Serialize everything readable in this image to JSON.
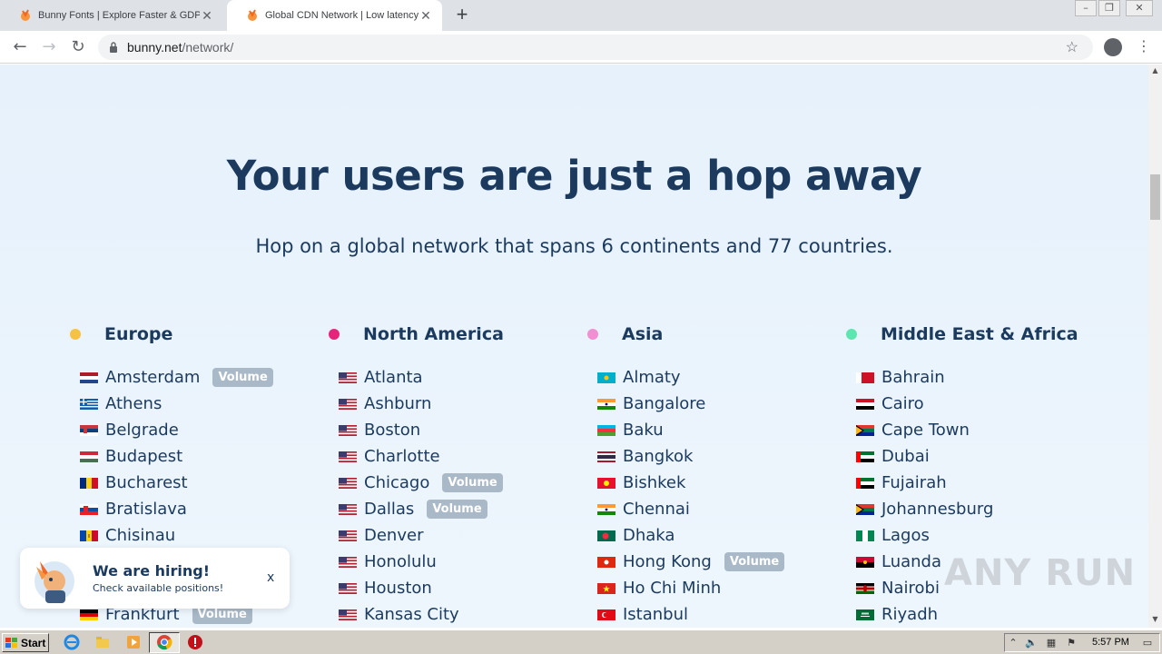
{
  "browser": {
    "tabs": [
      {
        "title": "Bunny Fonts | Explore Faster & GDPR",
        "active": false
      },
      {
        "title": "Global CDN Network | Low latency CDN",
        "active": true
      }
    ],
    "new_tab": "+",
    "url_host": "bunny.net",
    "url_path": "/network/"
  },
  "page": {
    "headline": "Your users are just a hop away",
    "subheadline": "Hop on a global network that spans 6 continents and 77 countries.",
    "volume_label": "Volume",
    "regions": [
      {
        "name": "Europe",
        "dot_color": "#f5c242",
        "cities": [
          {
            "name": "Amsterdam",
            "flag": "nl",
            "volume": true
          },
          {
            "name": "Athens",
            "flag": "gr",
            "volume": false
          },
          {
            "name": "Belgrade",
            "flag": "rs",
            "volume": false
          },
          {
            "name": "Budapest",
            "flag": "hu",
            "volume": false
          },
          {
            "name": "Bucharest",
            "flag": "ro",
            "volume": false
          },
          {
            "name": "Bratislava",
            "flag": "sk",
            "volume": false
          },
          {
            "name": "Chisinau",
            "flag": "md",
            "volume": false
          },
          {
            "name": "",
            "flag": "",
            "volume": false
          },
          {
            "name": "",
            "flag": "",
            "volume": false
          },
          {
            "name": "Frankfurt",
            "flag": "de",
            "volume": true
          }
        ]
      },
      {
        "name": "North America",
        "dot_color": "#e6257a",
        "cities": [
          {
            "name": "Atlanta",
            "flag": "us",
            "volume": false
          },
          {
            "name": "Ashburn",
            "flag": "us",
            "volume": false
          },
          {
            "name": "Boston",
            "flag": "us",
            "volume": false
          },
          {
            "name": "Charlotte",
            "flag": "us",
            "volume": false
          },
          {
            "name": "Chicago",
            "flag": "us",
            "volume": true
          },
          {
            "name": "Dallas",
            "flag": "us",
            "volume": true
          },
          {
            "name": "Denver",
            "flag": "us",
            "volume": false
          },
          {
            "name": "Honolulu",
            "flag": "us",
            "volume": false
          },
          {
            "name": "Houston",
            "flag": "us",
            "volume": false
          },
          {
            "name": "Kansas City",
            "flag": "us",
            "volume": false
          }
        ]
      },
      {
        "name": "Asia",
        "dot_color": "#f08fd2",
        "cities": [
          {
            "name": "Almaty",
            "flag": "kz",
            "volume": false
          },
          {
            "name": "Bangalore",
            "flag": "in",
            "volume": false
          },
          {
            "name": "Baku",
            "flag": "az",
            "volume": false
          },
          {
            "name": "Bangkok",
            "flag": "th",
            "volume": false
          },
          {
            "name": "Bishkek",
            "flag": "kg",
            "volume": false
          },
          {
            "name": "Chennai",
            "flag": "in",
            "volume": false
          },
          {
            "name": "Dhaka",
            "flag": "bd",
            "volume": false
          },
          {
            "name": "Hong Kong",
            "flag": "hk",
            "volume": true
          },
          {
            "name": "Ho Chi Minh",
            "flag": "vn",
            "volume": false
          },
          {
            "name": "Istanbul",
            "flag": "tr",
            "volume": false
          }
        ]
      },
      {
        "name": "Middle East & Africa",
        "dot_color": "#5ee6b0",
        "cities": [
          {
            "name": "Bahrain",
            "flag": "bh",
            "volume": false
          },
          {
            "name": "Cairo",
            "flag": "eg",
            "volume": false
          },
          {
            "name": "Cape Town",
            "flag": "za",
            "volume": false
          },
          {
            "name": "Dubai",
            "flag": "ae",
            "volume": false
          },
          {
            "name": "Fujairah",
            "flag": "ae",
            "volume": false
          },
          {
            "name": "Johannesburg",
            "flag": "za",
            "volume": false
          },
          {
            "name": "Lagos",
            "flag": "ng",
            "volume": false
          },
          {
            "name": "Luanda",
            "flag": "ao",
            "volume": false
          },
          {
            "name": "Nairobi",
            "flag": "ke",
            "volume": false
          },
          {
            "name": "Riyadh",
            "flag": "sa",
            "volume": false
          }
        ]
      }
    ]
  },
  "hiring_popup": {
    "title": "We are hiring!",
    "subtitle": "Check available positions!",
    "close": "x"
  },
  "watermark": "ANY RUN",
  "taskbar": {
    "start_label": "Start",
    "clock": "5:57 PM"
  }
}
